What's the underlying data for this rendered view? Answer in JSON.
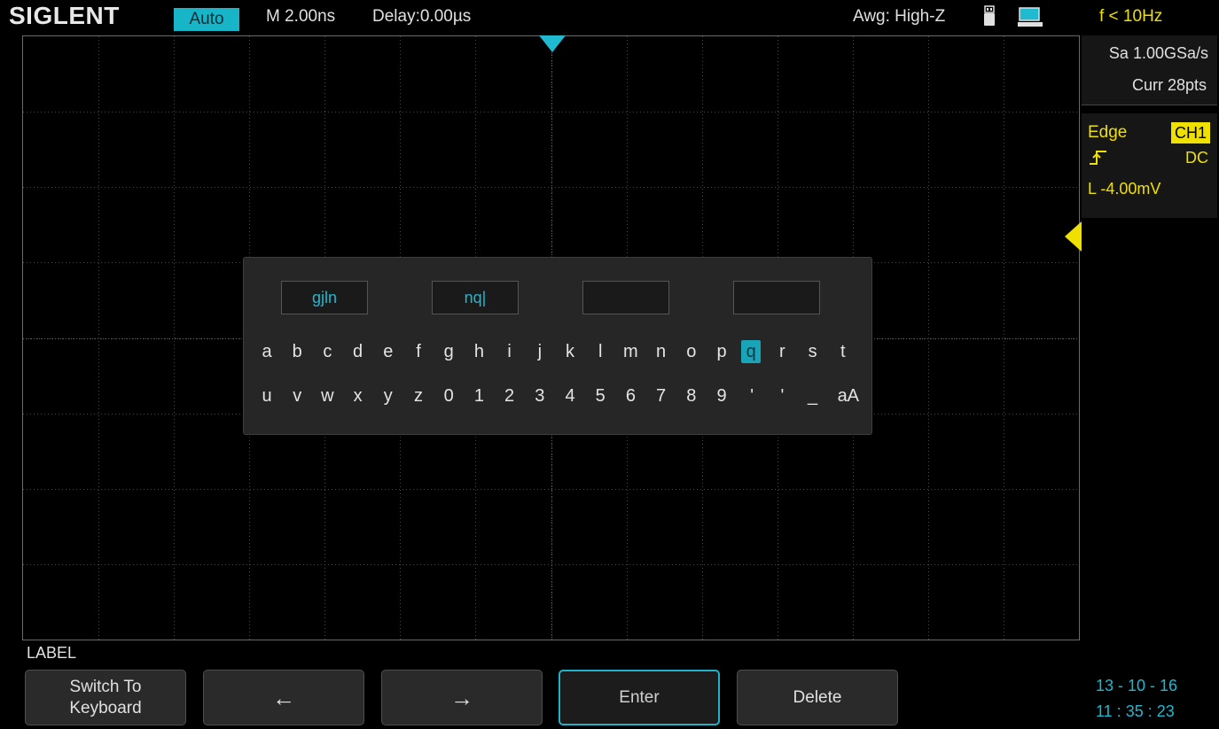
{
  "topbar": {
    "brand": "SIGLENT",
    "mode": "Auto",
    "timebase": "M 2.00ns",
    "delay": "Delay:0.00µs",
    "awg": "Awg: High-Z",
    "freq": "f < 10Hz",
    "icons": [
      "usb-icon",
      "pc-connection-icon"
    ]
  },
  "acquisition": {
    "sample_rate": "Sa 1.00GSa/s",
    "points": "Curr 28pts"
  },
  "trigger": {
    "type": "Edge",
    "source": "CH1",
    "coupling": "DC",
    "level": "L  -4.00mV",
    "slope_icon": "rising-edge-icon"
  },
  "label_dialog": {
    "slots": [
      "gjln",
      "nq|",
      "",
      ""
    ],
    "row1": [
      "a",
      "b",
      "c",
      "d",
      "e",
      "f",
      "g",
      "h",
      "i",
      "j",
      "k",
      "l",
      "m",
      "n",
      "o",
      "p",
      "q",
      "r",
      "s",
      "t"
    ],
    "row2": [
      "u",
      "v",
      "w",
      "x",
      "y",
      "z",
      "0",
      "1",
      "2",
      "3",
      "4",
      "5",
      "6",
      "7",
      "8",
      "9",
      "'",
      "'",
      "_",
      "aA"
    ],
    "selected_key": "q"
  },
  "menu": {
    "title": "LABEL",
    "softkeys": [
      {
        "label": "Switch To\nKeyboard"
      },
      {
        "label": "←"
      },
      {
        "label": "→"
      },
      {
        "label": "Enter"
      },
      {
        "label": "Delete"
      }
    ]
  },
  "clock": {
    "date": "13 - 10 - 16",
    "time": "11 : 35 : 23"
  },
  "colors": {
    "accent": "#1fb9d0",
    "trigger": "#f0e000",
    "grid": "#3a3a3a"
  }
}
